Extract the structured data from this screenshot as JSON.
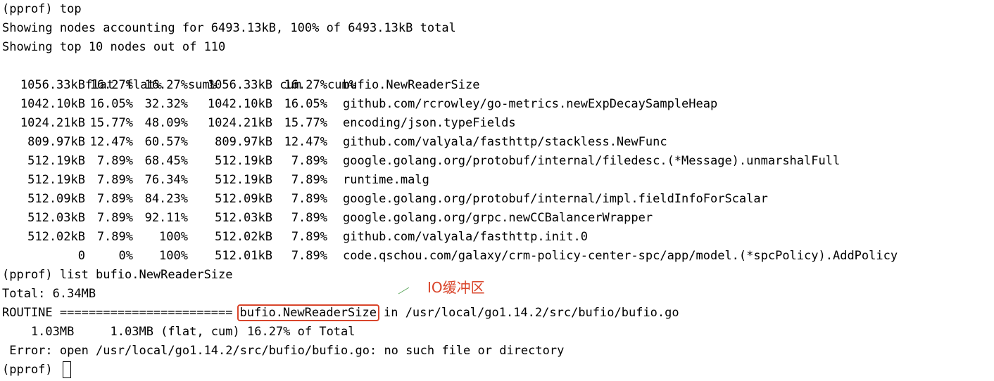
{
  "terminal": {
    "prompt1": "(pprof) top",
    "summary1": "Showing nodes accounting for 6493.13kB, 100% of 6493.13kB total",
    "summary2": "Showing top 10 nodes out of 110",
    "headers": [
      "flat",
      "flat%",
      "sum%",
      "cum",
      "cum%"
    ],
    "rows": [
      {
        "flat": "1056.33kB",
        "flatp": "16.27%",
        "sum": "16.27%",
        "cum": "1056.33kB",
        "cump": "16.27%",
        "name": "bufio.NewReaderSize"
      },
      {
        "flat": "1042.10kB",
        "flatp": "16.05%",
        "sum": "32.32%",
        "cum": "1042.10kB",
        "cump": "16.05%",
        "name": "github.com/rcrowley/go-metrics.newExpDecaySampleHeap"
      },
      {
        "flat": "1024.21kB",
        "flatp": "15.77%",
        "sum": "48.09%",
        "cum": "1024.21kB",
        "cump": "15.77%",
        "name": "encoding/json.typeFields"
      },
      {
        "flat": "809.97kB",
        "flatp": "12.47%",
        "sum": "60.57%",
        "cum": "809.97kB",
        "cump": "12.47%",
        "name": "github.com/valyala/fasthttp/stackless.NewFunc"
      },
      {
        "flat": "512.19kB",
        "flatp": "7.89%",
        "sum": "68.45%",
        "cum": "512.19kB",
        "cump": "7.89%",
        "name": "google.golang.org/protobuf/internal/filedesc.(*Message).unmarshalFull"
      },
      {
        "flat": "512.19kB",
        "flatp": "7.89%",
        "sum": "76.34%",
        "cum": "512.19kB",
        "cump": "7.89%",
        "name": "runtime.malg"
      },
      {
        "flat": "512.09kB",
        "flatp": "7.89%",
        "sum": "84.23%",
        "cum": "512.09kB",
        "cump": "7.89%",
        "name": "google.golang.org/protobuf/internal/impl.fieldInfoForScalar"
      },
      {
        "flat": "512.03kB",
        "flatp": "7.89%",
        "sum": "92.11%",
        "cum": "512.03kB",
        "cump": "7.89%",
        "name": "google.golang.org/grpc.newCCBalancerWrapper"
      },
      {
        "flat": "512.02kB",
        "flatp": "7.89%",
        "sum": "100%",
        "cum": "512.02kB",
        "cump": "7.89%",
        "name": "github.com/valyala/fasthttp.init.0"
      },
      {
        "flat": "0",
        "flatp": "0%",
        "sum": "100%",
        "cum": "512.01kB",
        "cump": "7.89%",
        "name": "code.qschou.com/galaxy/crm-policy-center-spc/app/model.(*spcPolicy).AddPolicy"
      }
    ],
    "prompt2": "(pprof) list bufio.NewReaderSize",
    "total": "Total: 6.34MB",
    "routine_prefix": "ROUTINE ========================",
    "routine_func": "bufio.NewReaderSize",
    "routine_suffix": "in /usr/local/go1.14.2/src/bufio/bufio.go",
    "detail": "    1.03MB     1.03MB (flat, cum) 16.27% of Total",
    "error": " Error: open /usr/local/go1.14.2/src/bufio/bufio.go: no such file or directory",
    "prompt3": "(pprof) "
  },
  "annotation": {
    "label": "IO缓冲区",
    "color": "#d9452b"
  }
}
